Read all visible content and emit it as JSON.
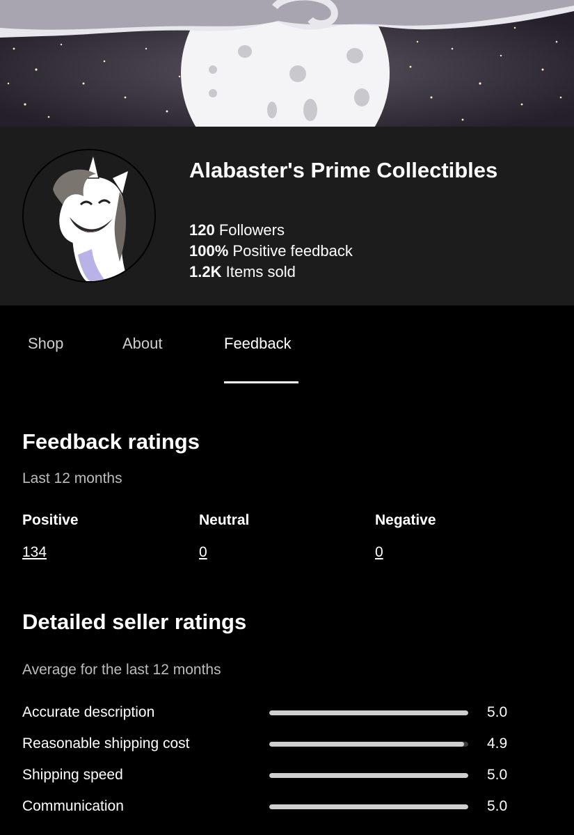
{
  "store": {
    "name": "Alabaster's Prime Collectibles",
    "stats": [
      {
        "value": "120",
        "label": "Followers"
      },
      {
        "value": "100%",
        "label": "Positive feedback"
      },
      {
        "value": "1.2K",
        "label": "Items sold"
      }
    ]
  },
  "tabs": [
    {
      "label": "Shop",
      "active": false
    },
    {
      "label": "About",
      "active": false
    },
    {
      "label": "Feedback",
      "active": true
    }
  ],
  "feedback_ratings": {
    "title": "Feedback ratings",
    "period": "Last 12 months",
    "columns": [
      {
        "label": "Positive",
        "value": "134"
      },
      {
        "label": "Neutral",
        "value": "0"
      },
      {
        "label": "Negative",
        "value": "0"
      }
    ]
  },
  "detailed_ratings": {
    "title": "Detailed seller ratings",
    "period": "Average for the last 12 months",
    "max_score": 5,
    "items": [
      {
        "label": "Accurate description",
        "score": 5.0,
        "display": "5.0"
      },
      {
        "label": "Reasonable shipping cost",
        "score": 4.9,
        "display": "4.9"
      },
      {
        "label": "Shipping speed",
        "score": 5.0,
        "display": "5.0"
      },
      {
        "label": "Communication",
        "score": 5.0,
        "display": "5.0"
      }
    ]
  }
}
